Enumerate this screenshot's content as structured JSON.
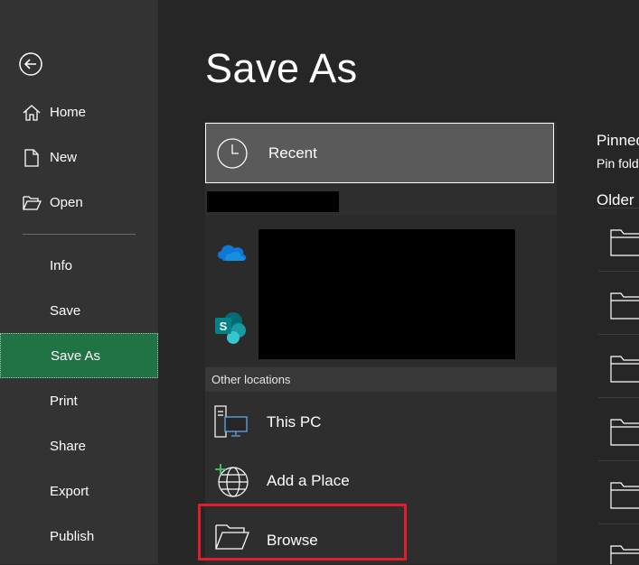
{
  "sidebar": {
    "back_icon": "arrow-left-circle-icon",
    "items": [
      {
        "label": "Home",
        "icon": "home-icon"
      },
      {
        "label": "New",
        "icon": "new-document-icon"
      },
      {
        "label": "Open",
        "icon": "open-folder-icon"
      },
      {
        "label": "Info"
      },
      {
        "label": "Save"
      },
      {
        "label": "Save As",
        "active": true
      },
      {
        "label": "Print"
      },
      {
        "label": "Share"
      },
      {
        "label": "Export"
      },
      {
        "label": "Publish"
      }
    ]
  },
  "main": {
    "title": "Save As",
    "recent": {
      "label": "Recent",
      "icon": "clock-icon"
    },
    "accounts": [
      {
        "icon": "onedrive-icon"
      },
      {
        "icon": "sharepoint-icon"
      }
    ],
    "other_locations_header": "Other locations",
    "locations": [
      {
        "label": "This PC",
        "icon": "this-pc-icon"
      },
      {
        "label": "Add a Place",
        "icon": "add-place-globe-icon"
      },
      {
        "label": "Browse",
        "icon": "browse-folder-icon"
      }
    ]
  },
  "right_panel": {
    "pinned_title": "Pinned",
    "pinned_subtitle": "Pin fold",
    "older_title": "Older",
    "folder_icon": "folder-icon"
  },
  "colors": {
    "sidebar_bg": "#333333",
    "main_bg": "#262626",
    "active_accent": "#217346",
    "highlight_box": "#e01e2b"
  }
}
